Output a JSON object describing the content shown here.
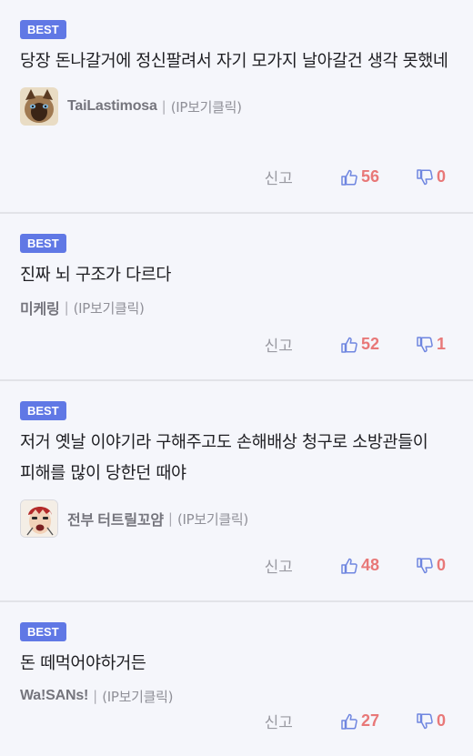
{
  "comments": [
    {
      "badge": "BEST",
      "text": "당장 돈나갈거에 정신팔려서 자기 모가지 날아갈건 생각 못했네",
      "author": "TaiLastimosa",
      "ip": "(IP보기클릭)",
      "report": "신고",
      "likes": "56",
      "dislikes": "0"
    },
    {
      "badge": "BEST",
      "text": "진짜 뇌 구조가 다르다",
      "author": "미케링",
      "ip": "(IP보기클릭)",
      "report": "신고",
      "likes": "52",
      "dislikes": "1"
    },
    {
      "badge": "BEST",
      "text": "저거 옛날 이야기라 구해주고도 손해배상 청구로 소방관들이 피해를 많이 당한던 때야",
      "author": "전부 터트릴꼬얌",
      "ip": "(IP보기클릭)",
      "report": "신고",
      "likes": "48",
      "dislikes": "0"
    },
    {
      "badge": "BEST",
      "text": "돈 떼먹어야하거든",
      "author": "Wa!SANs!",
      "ip": "(IP보기클릭)",
      "report": "신고",
      "likes": "27",
      "dislikes": "0"
    }
  ],
  "separator": "|",
  "colors": {
    "badge": "#6078e5",
    "vote": "#e87878",
    "like_icon": "#6f86e0",
    "background": "#f5f6fb"
  },
  "icons": {
    "like": "thumbs-up-icon",
    "dislike": "thumbs-down-icon"
  }
}
